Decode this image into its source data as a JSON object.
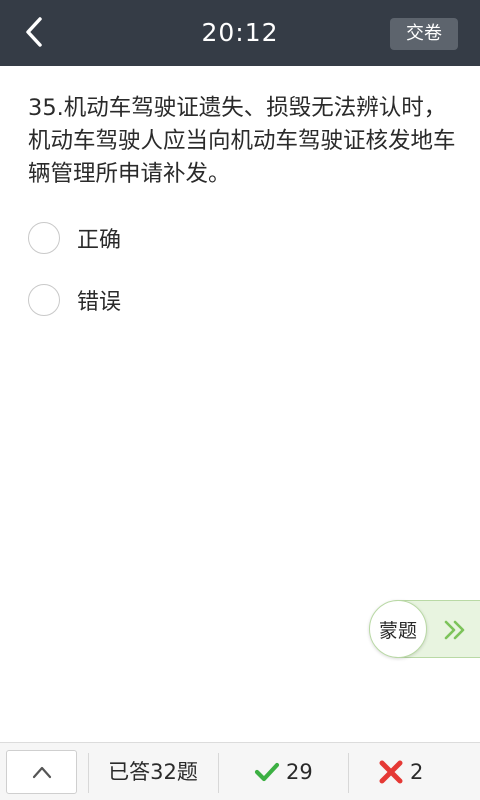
{
  "header": {
    "timer": "20:12",
    "submit_label": "交卷",
    "back_icon": "chevron-left-icon",
    "background": "#353c46"
  },
  "question": {
    "text": "35.机动车驾驶证遗失、损毁无法辨认时，机动车驾驶人应当向机动车驾驶证核发地车辆管理所申请补发。"
  },
  "options": [
    {
      "label": "正确"
    },
    {
      "label": "错误"
    }
  ],
  "mengti": {
    "label": "蒙题",
    "icon": "double-chevron-right-icon",
    "accent": "#7cc35a"
  },
  "footer": {
    "up_icon": "chevron-up-icon",
    "answered": "已答32题",
    "correct_count": "29",
    "correct_icon": "check-icon",
    "correct_color": "#3cb043",
    "wrong_count": "2",
    "wrong_icon": "cross-icon",
    "wrong_color": "#e53935"
  }
}
